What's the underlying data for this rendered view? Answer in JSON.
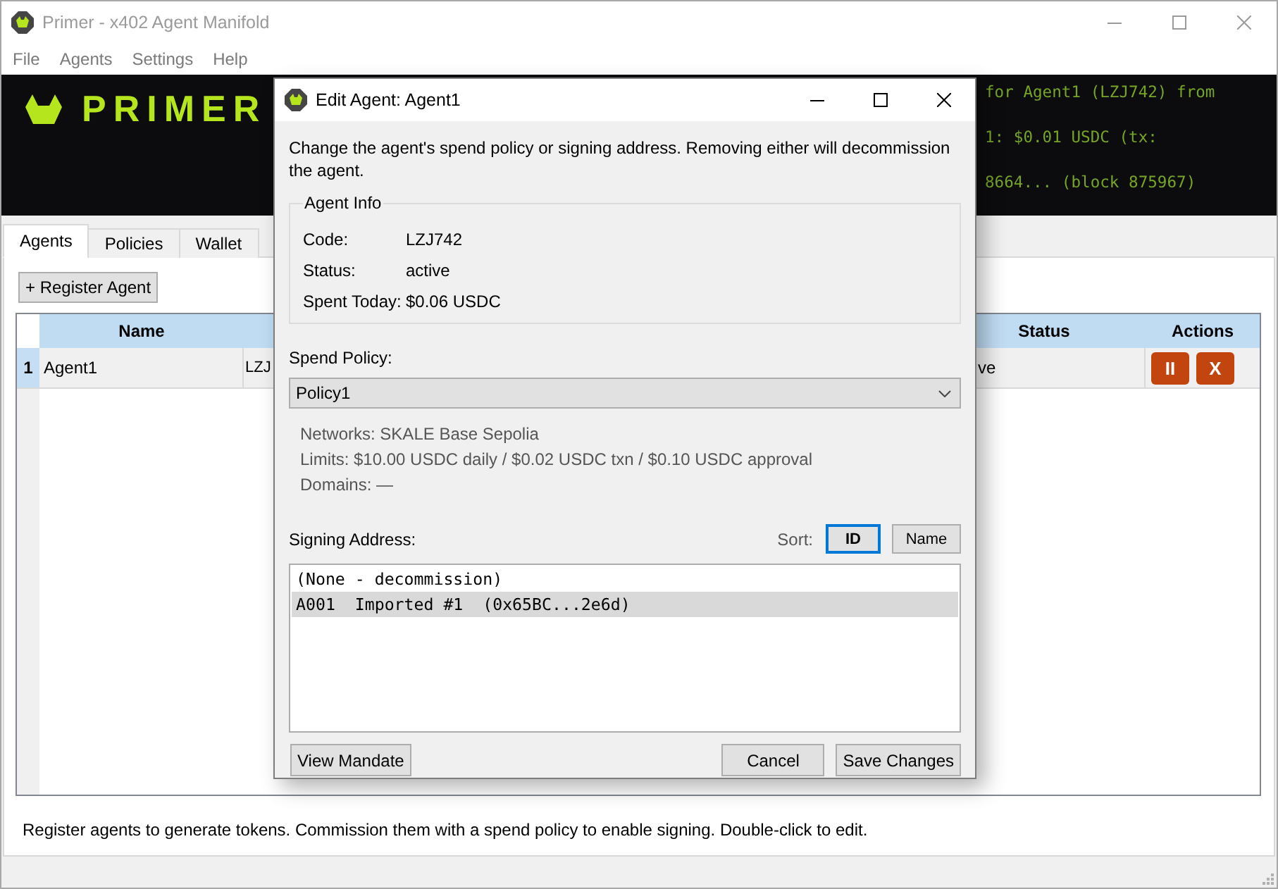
{
  "window": {
    "title": "Primer - x402 Agent Manifold"
  },
  "menu": [
    {
      "label": "File"
    },
    {
      "label": "Agents"
    },
    {
      "label": "Settings"
    },
    {
      "label": "Help"
    }
  ],
  "banner": {
    "logo_text": "PRIMER",
    "log_lines": [
      "for Agent1 (LZJ742) from",
      "1: $0.01 USDC (tx:",
      "8664... (block 875967)"
    ]
  },
  "tabs": [
    {
      "label": "Agents",
      "selected": true
    },
    {
      "label": "Policies",
      "selected": false
    },
    {
      "label": "Wallet",
      "selected": false
    }
  ],
  "register_button": "+ Register Agent",
  "table": {
    "columns": [
      "Name",
      "Status",
      "Actions"
    ],
    "rows": [
      {
        "number": "1",
        "name": "Agent1",
        "column_3": "LZJ",
        "status": "ve",
        "actions": [
          "II",
          "X"
        ]
      }
    ]
  },
  "status_bar": "Register agents to generate tokens. Commission them with a spend policy to enable signing. Double-click to edit.",
  "dialog": {
    "title": "Edit Agent: Agent1",
    "description": "Change the agent's spend policy or signing address. Removing either will decommission the agent.",
    "agent_info": {
      "title": "Agent Info",
      "fields": [
        {
          "label": "Code:",
          "value": "LZJ742"
        },
        {
          "label": "Status:",
          "value": "active"
        },
        {
          "label": "Spent Today:",
          "value": "$0.06 USDC"
        }
      ]
    },
    "spend_policy": {
      "label": "Spend Policy:",
      "value": "Policy1",
      "details": [
        "Networks: SKALE Base Sepolia",
        "Limits: $10.00 USDC daily / $0.02 USDC txn / $0.10 USDC approval",
        "Domains: —"
      ]
    },
    "signing_address": {
      "label": "Signing Address:",
      "sort_label": "Sort:",
      "sort_options": [
        {
          "label": "ID",
          "selected": true
        },
        {
          "label": "Name",
          "selected": false
        }
      ],
      "items": [
        {
          "text": "(None - decommission)",
          "selected": false
        },
        {
          "text": "A001  Imported #1  (0x65BC...2e6d)",
          "selected": true
        }
      ]
    },
    "buttons": [
      {
        "label": "View Mandate"
      },
      {
        "label": "Cancel"
      },
      {
        "label": "Save Changes"
      }
    ]
  }
}
